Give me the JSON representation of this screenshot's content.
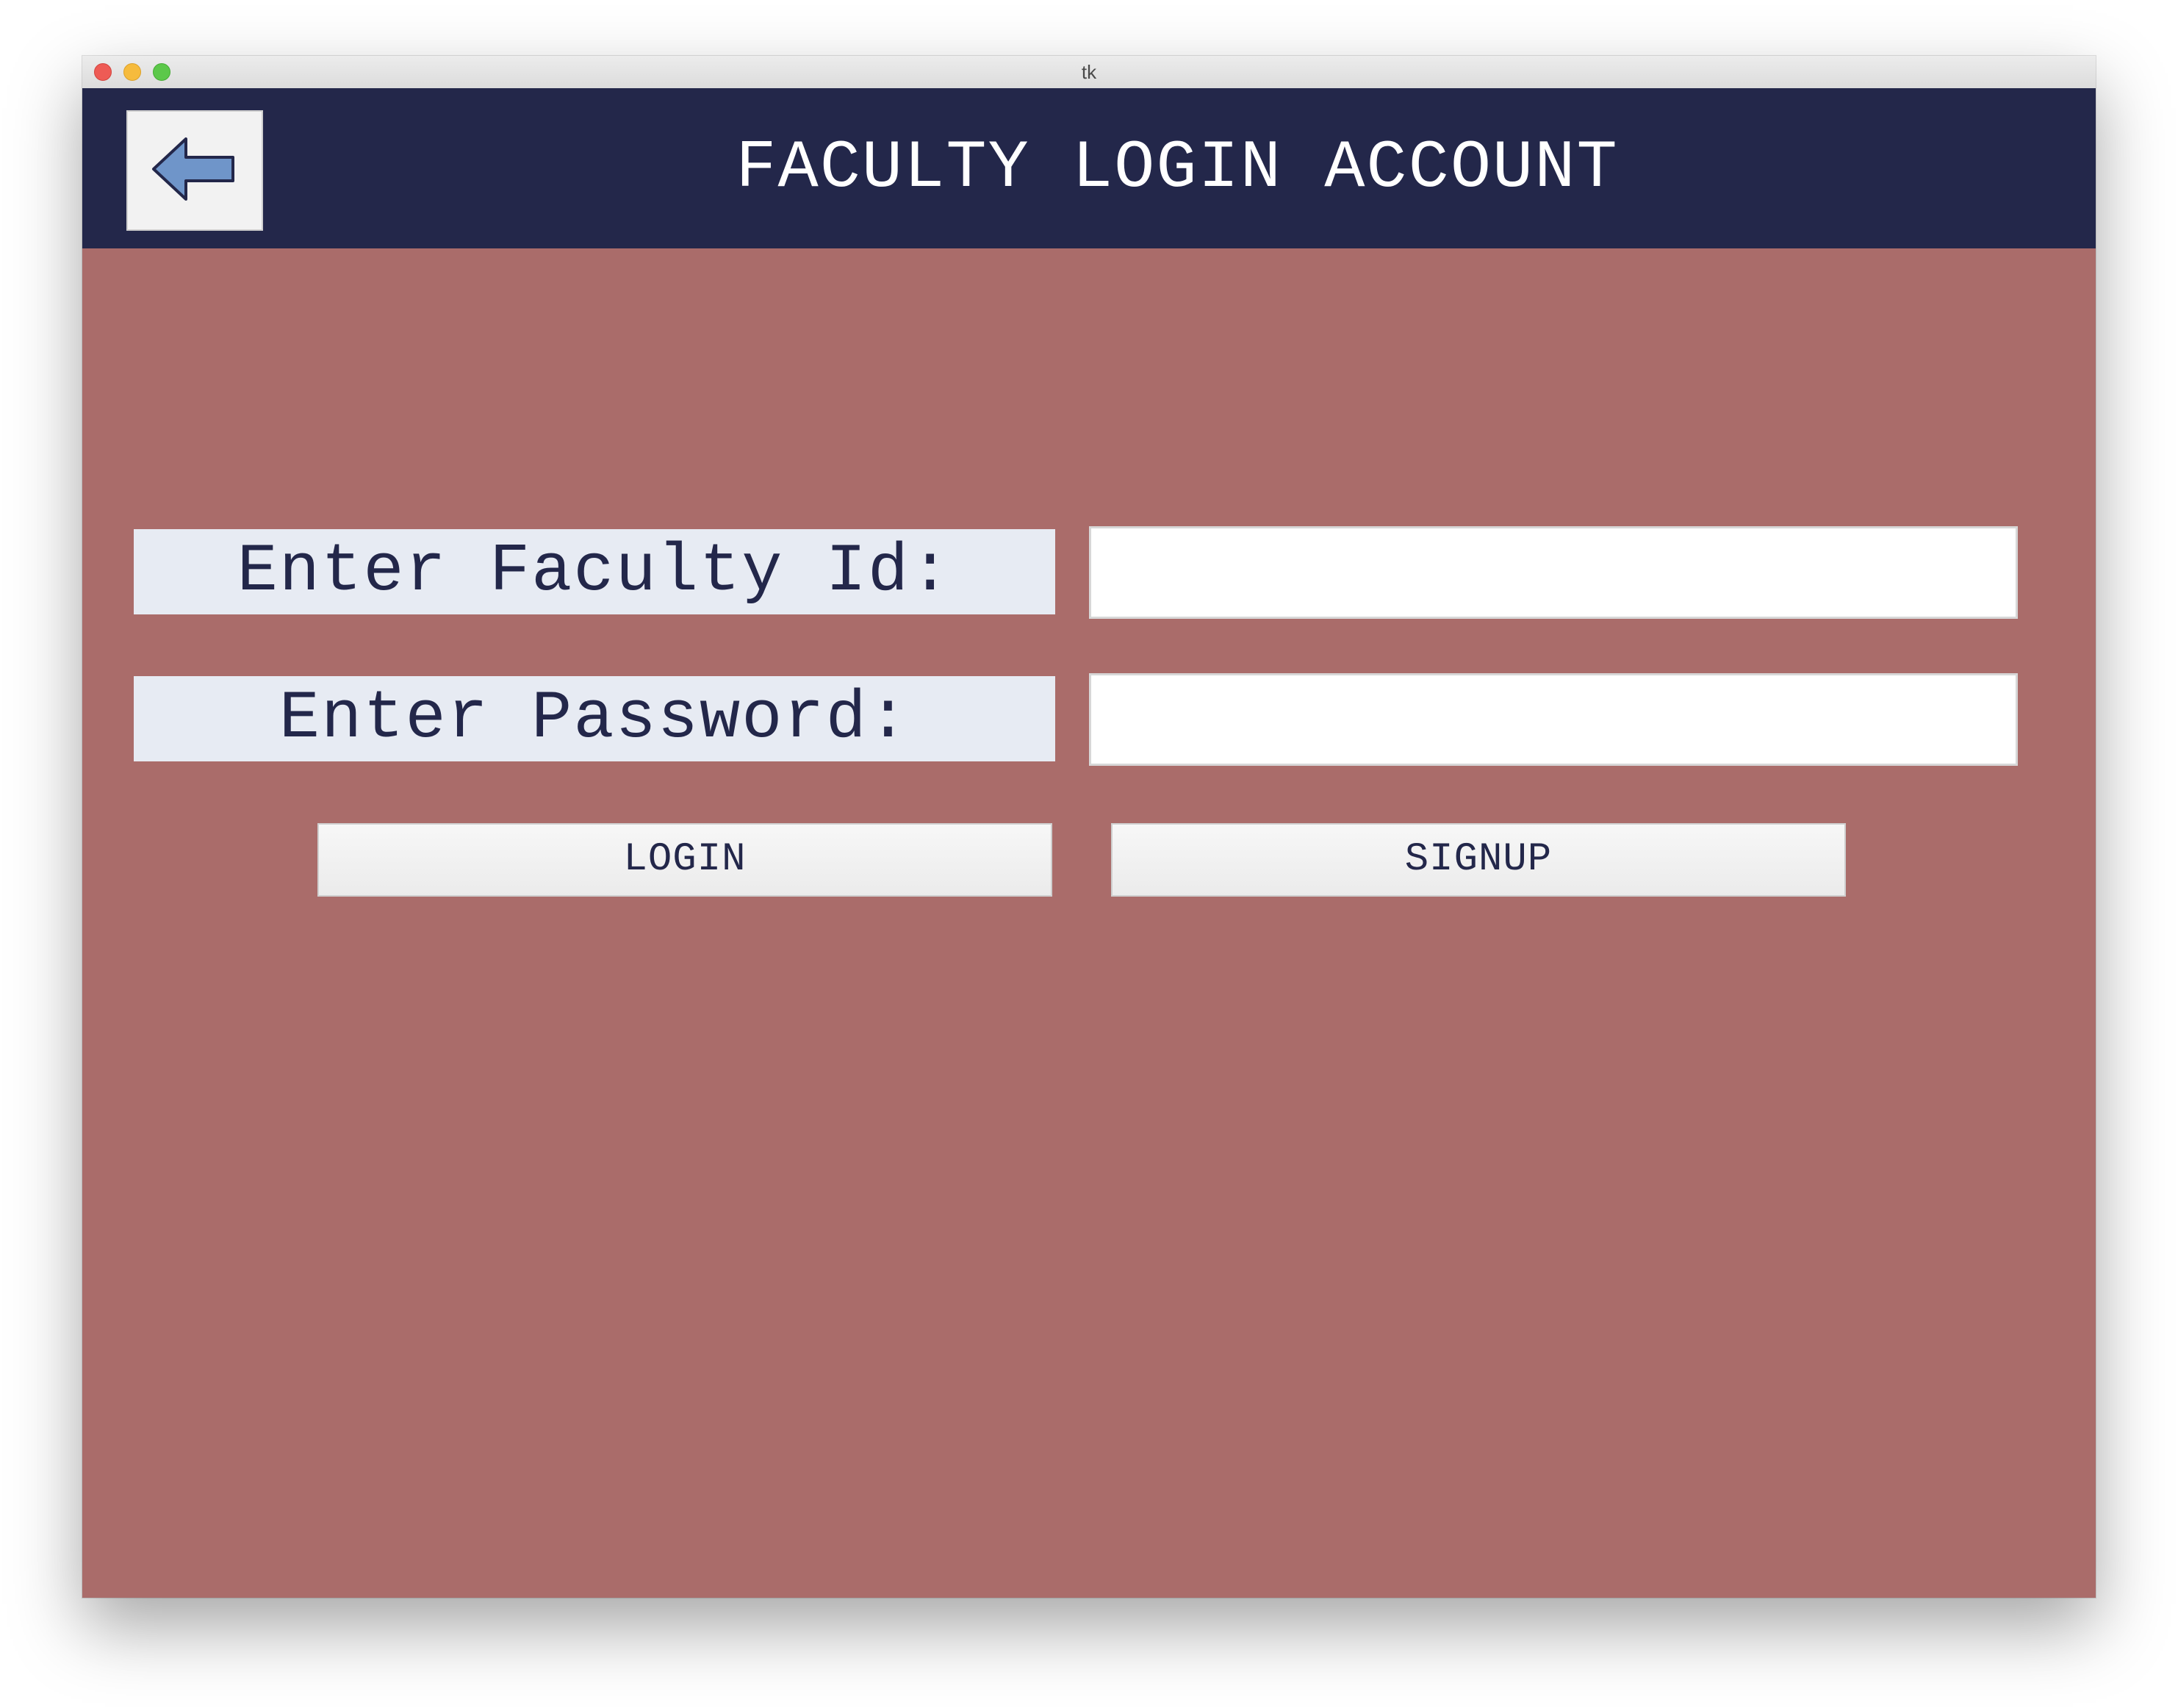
{
  "window": {
    "title": "tk"
  },
  "header": {
    "title": "FACULTY LOGIN ACCOUNT",
    "back_icon": "arrow-left-icon"
  },
  "form": {
    "faculty_id_label": "Enter Faculty Id:",
    "faculty_id_value": "",
    "password_label": "Enter Password:",
    "password_value": ""
  },
  "buttons": {
    "login_label": "LOGIN",
    "signup_label": "SIGNUP"
  },
  "colors": {
    "header_bg": "#23274a",
    "body_bg": "#aa6c6a",
    "label_bg": "#e7ebf3",
    "arrow_fill": "#6f95c9"
  }
}
